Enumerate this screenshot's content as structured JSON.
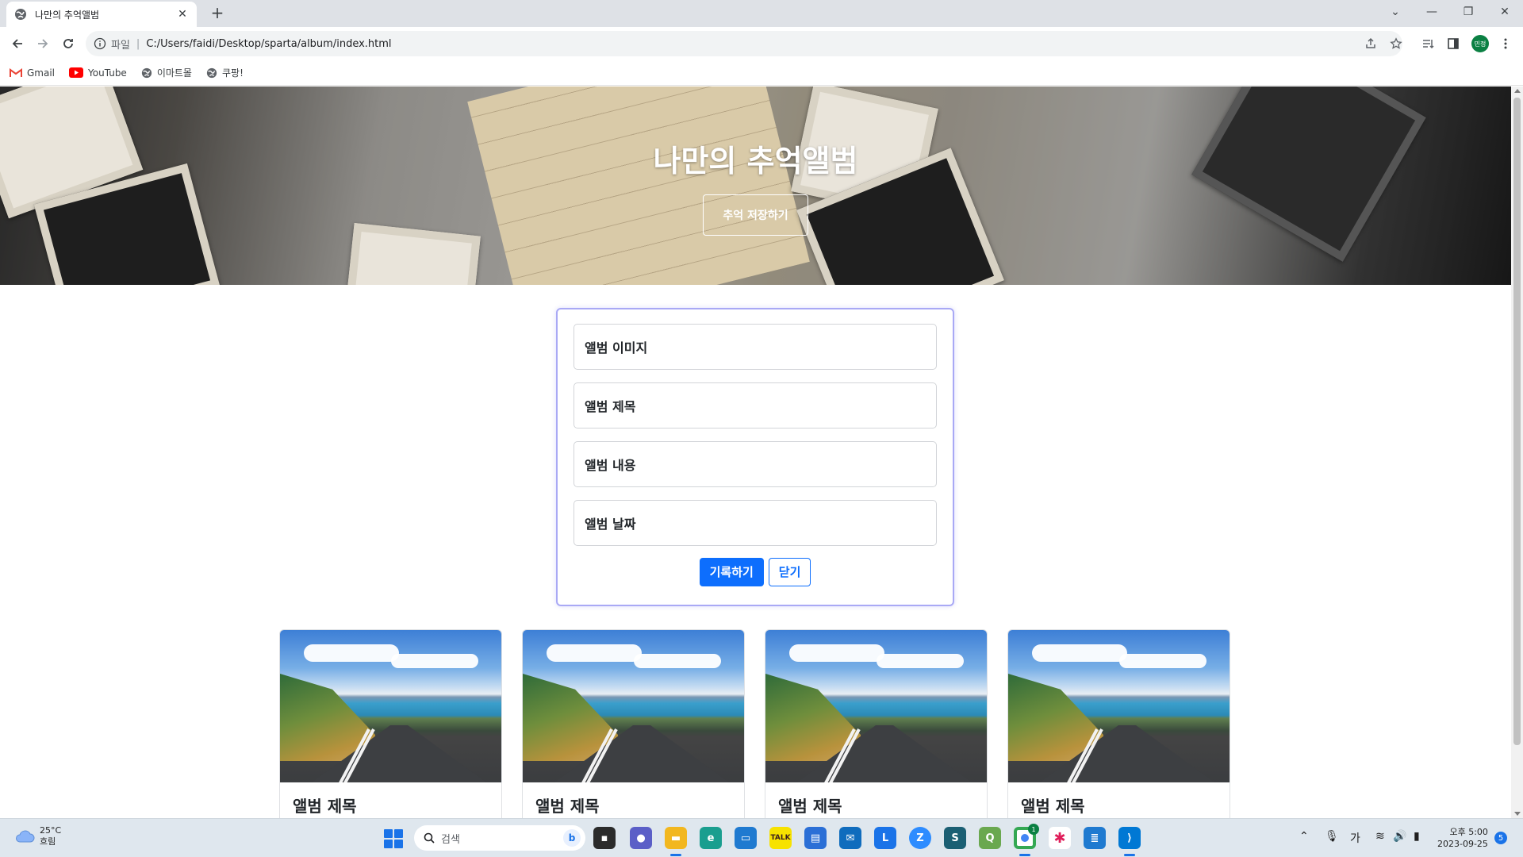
{
  "browser": {
    "tab_title": "나만의 추억앨범",
    "address_scheme": "파일",
    "address_url": "C:/Users/faidi/Desktop/sparta/album/index.html",
    "profile_initials": "민정",
    "bookmarks": [
      {
        "label": "Gmail",
        "icon": "gmail-icon"
      },
      {
        "label": "YouTube",
        "icon": "youtube-icon"
      },
      {
        "label": "이마트몰",
        "icon": "globe-icon"
      },
      {
        "label": "쿠팡!",
        "icon": "globe-icon"
      }
    ]
  },
  "hero": {
    "title": "나만의 추억앨범",
    "button_label": "추억 저장하기"
  },
  "form": {
    "image_placeholder": "앨범 이미지",
    "title_placeholder": "앨범 제목",
    "content_placeholder": "앨범 내용",
    "date_placeholder": "앨범 날짜",
    "submit_label": "기록하기",
    "close_label": "닫기"
  },
  "albums": [
    {
      "title": "앨범 제목"
    },
    {
      "title": "앨범 제목"
    },
    {
      "title": "앨범 제목"
    },
    {
      "title": "앨범 제목"
    }
  ],
  "taskbar": {
    "weather_temp": "25°C",
    "weather_desc": "흐림",
    "search_label": "검색",
    "ime_label": "가",
    "time": "오후 5:00",
    "date": "2023-09-25",
    "chrome_badge": "1",
    "notification_count": "5"
  },
  "colors": {
    "primary": "#0d6efd",
    "form_border": "#a9a9f5"
  }
}
